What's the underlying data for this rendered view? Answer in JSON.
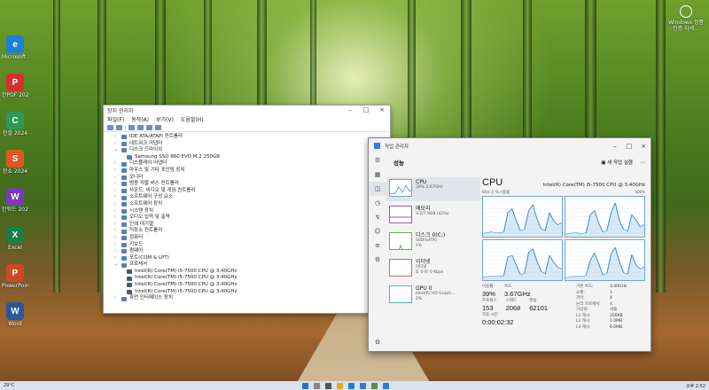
{
  "desktop": {
    "icons": [
      {
        "label": "Microsoft Edge",
        "glyph": "e",
        "color": "#1b7fd6"
      },
      {
        "label": "한PDF 2024",
        "glyph": "P",
        "color": "#d43030"
      },
      {
        "label": "한셀 2024",
        "glyph": "C",
        "color": "#2e9a55"
      },
      {
        "label": "한쇼 2024",
        "glyph": "S",
        "color": "#e0562a"
      },
      {
        "label": "한워드 2024",
        "glyph": "W",
        "color": "#7b3bb5"
      },
      {
        "label": "Excel",
        "glyph": "X",
        "color": "#1f7a45"
      },
      {
        "label": "PowerPoint",
        "glyph": "P",
        "color": "#c94a24"
      },
      {
        "label": "Word",
        "glyph": "W",
        "color": "#2b579a"
      }
    ],
    "corner_widget": {
      "label": "Windows 정품 인증 자세..."
    }
  },
  "device_manager": {
    "title": "장치 관리자",
    "menu": [
      "파일(F)",
      "동작(A)",
      "보기(V)",
      "도움말(H)"
    ],
    "tree": [
      {
        "label": "IDE ATA/ATAPI 컨트롤러",
        "expanded": false
      },
      {
        "label": "네트워크 어댑터",
        "expanded": false
      },
      {
        "label": "디스크 드라이브",
        "expanded": true
      },
      {
        "label": "Samsung SSD 860 EVO M.2 250GB",
        "child": true
      },
      {
        "label": "디스플레이 어댑터",
        "expanded": false
      },
      {
        "label": "마우스 및 기타 포인팅 장치",
        "expanded": false
      },
      {
        "label": "모니터",
        "expanded": false
      },
      {
        "label": "범용 직렬 버스 컨트롤러",
        "expanded": false
      },
      {
        "label": "사운드, 비디오 및 게임 컨트롤러",
        "expanded": false
      },
      {
        "label": "소프트웨어 구성 요소",
        "expanded": false
      },
      {
        "label": "소프트웨어 장치",
        "expanded": false
      },
      {
        "label": "시스템 장치",
        "expanded": false
      },
      {
        "label": "오디오 입력 및 출력",
        "expanded": false
      },
      {
        "label": "인쇄 대기열",
        "expanded": false
      },
      {
        "label": "저장소 컨트롤러",
        "expanded": false
      },
      {
        "label": "컴퓨터",
        "expanded": false
      },
      {
        "label": "키보드",
        "expanded": false
      },
      {
        "label": "펌웨어",
        "expanded": false
      },
      {
        "label": "포트(COM & LPT)",
        "expanded": false
      },
      {
        "label": "프로세서",
        "expanded": true
      },
      {
        "label": "Intel(R) Core(TM) i5-7500 CPU @ 3.40GHz",
        "child": true,
        "chip": true
      },
      {
        "label": "Intel(R) Core(TM) i5-7500 CPU @ 3.40GHz",
        "child": true,
        "chip": true
      },
      {
        "label": "Intel(R) Core(TM) i5-7500 CPU @ 3.40GHz",
        "child": true,
        "chip": true
      },
      {
        "label": "Intel(R) Core(TM) i5-7500 CPU @ 3.40GHz",
        "child": true,
        "chip": true
      },
      {
        "label": "휴먼 인터페이스 장치",
        "expanded": false
      }
    ]
  },
  "task_manager": {
    "title": "작업 관리자",
    "section": "성능",
    "run_new_task": "새 작업 실행",
    "items": [
      {
        "name": "CPU",
        "sub": "39% 3.67GHz",
        "kind": "cpu",
        "selected": true
      },
      {
        "name": "메모리",
        "sub": "3.2/7.9GB (41%)",
        "kind": "mem"
      },
      {
        "name": "디스크 0(C:)",
        "sub": "SSD(SATA)",
        "sub2": "1%",
        "kind": "disk"
      },
      {
        "name": "이더넷",
        "sub": "이더넷",
        "sub2": "S: 0 R: 0 Kbps",
        "kind": "net"
      },
      {
        "name": "GPU 0",
        "sub": "Intel(R) HD Graph...",
        "sub2": "2%",
        "kind": "gpu"
      }
    ],
    "detail": {
      "heading": "CPU",
      "model": "Intel(R) Core(TM) i5-7500 CPU @ 3.40GHz",
      "axis_left": "60초 간 % 이용률",
      "axis_right": "100%",
      "utilization_label": "이용률",
      "utilization": "39%",
      "speed_label": "속도",
      "speed": "3.67GHz",
      "processes_label": "프로세스",
      "processes": "153",
      "threads_label": "스레드",
      "threads": "2068",
      "handles_label": "핸들",
      "handles": "62101",
      "uptime_label": "작동 시간",
      "uptime": "0:00:02:32",
      "specs": [
        {
          "k": "기본 속도:",
          "v": "3.40GHz"
        },
        {
          "k": "소켓:",
          "v": "1"
        },
        {
          "k": "코어:",
          "v": "4"
        },
        {
          "k": "논리 프로세서:",
          "v": "4"
        },
        {
          "k": "가상화:",
          "v": "사용"
        },
        {
          "k": "L1 캐시:",
          "v": "256KB"
        },
        {
          "k": "L2 캐시:",
          "v": "1.0MB"
        },
        {
          "k": "L3 캐시:",
          "v": "6.0MB"
        }
      ],
      "graphs": [
        [
          8,
          10,
          12,
          10,
          9,
          12,
          60,
          70,
          40,
          15,
          18,
          65,
          80,
          45,
          20,
          15,
          60,
          40,
          30,
          35
        ],
        [
          6,
          8,
          10,
          9,
          8,
          10,
          55,
          65,
          35,
          12,
          15,
          60,
          85,
          40,
          18,
          14,
          55,
          42,
          25,
          30
        ],
        [
          7,
          9,
          10,
          9,
          10,
          11,
          58,
          62,
          38,
          14,
          16,
          70,
          78,
          48,
          22,
          16,
          62,
          45,
          32,
          28
        ],
        [
          6,
          8,
          9,
          10,
          9,
          12,
          50,
          68,
          42,
          13,
          17,
          66,
          82,
          46,
          19,
          15,
          64,
          38,
          28,
          33
        ]
      ]
    }
  },
  "taskbar": {
    "weather": "29°C",
    "tray": "오후 2:52"
  }
}
